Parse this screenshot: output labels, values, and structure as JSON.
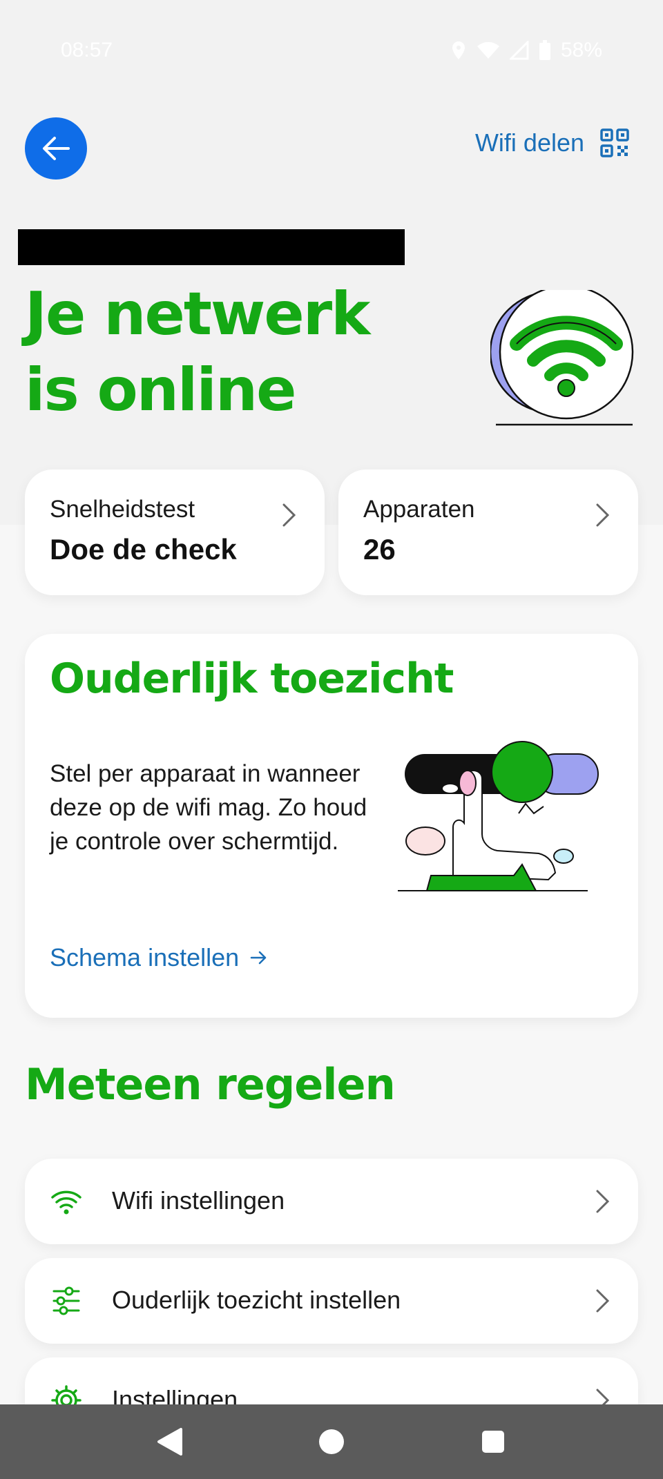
{
  "status_bar": {
    "time": "08:57",
    "battery": "58%",
    "icons": [
      "location-icon",
      "wifi-icon",
      "signal-icon",
      "battery-icon"
    ]
  },
  "header": {
    "back_icon": "arrow-left-icon",
    "share_label": "Wifi delen",
    "share_icon": "qr-code-icon"
  },
  "hero": {
    "title": "Je netwerk\nis online",
    "illustration": "wifi-online-icon"
  },
  "tiles": [
    {
      "label": "Snelheidstest",
      "value": "Doe de check"
    },
    {
      "label": "Apparaten",
      "value": "26"
    }
  ],
  "parental": {
    "title": "Ouderlijk toezicht",
    "text": "Stel per apparaat in wanneer deze op de wifi mag. Zo houd je controle over schermtijd.",
    "link": "Schema instellen"
  },
  "quick_settings": {
    "title": "Meteen regelen",
    "items": [
      {
        "label": "Wifi instellingen",
        "icon": "wifi-icon"
      },
      {
        "label": "Ouderlijk toezicht instellen",
        "icon": "sliders-icon"
      },
      {
        "label": "Instellingen",
        "icon": "gear-icon"
      }
    ]
  },
  "colors": {
    "brand_green": "#15a915",
    "link_blue": "#1a6fb8",
    "back_blue": "#0f6de8",
    "nav_gray": "#5b5b5b"
  }
}
